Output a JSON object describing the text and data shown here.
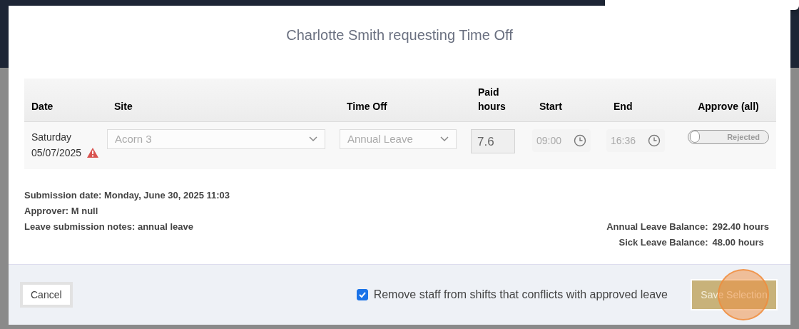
{
  "dialog": {
    "title": "Charlotte Smith requesting Time Off"
  },
  "table": {
    "columns": [
      "Date",
      "Site",
      "Time Off",
      "Paid hours",
      "Start",
      "End",
      "Approve (all)"
    ],
    "rows": [
      {
        "day": "Saturday",
        "date": "05/07/2025",
        "warning": true,
        "site": "Acorn 3",
        "time_off": "Annual Leave",
        "paid_hours": "7.6",
        "start": "09:00",
        "end": "16:36",
        "approved": false,
        "status_label": "Rejected"
      }
    ]
  },
  "details": [
    {
      "label": "Submission date:",
      "value": "Monday, June 30, 2025 11:03"
    },
    {
      "label": "Approver:",
      "value": "M null"
    },
    {
      "label": "Leave submission notes:",
      "value": "annual leave"
    }
  ],
  "balances": [
    {
      "label": "Annual Leave Balance:",
      "value": "292.40 hours"
    },
    {
      "label": "Sick Leave Balance:",
      "value": "48.00 hours"
    }
  ],
  "footer": {
    "cancel": "Cancel",
    "remove_staff": {
      "label": "Remove staff from shifts that conflicts with approved leave",
      "checked": true
    },
    "save": "Save Selection"
  }
}
